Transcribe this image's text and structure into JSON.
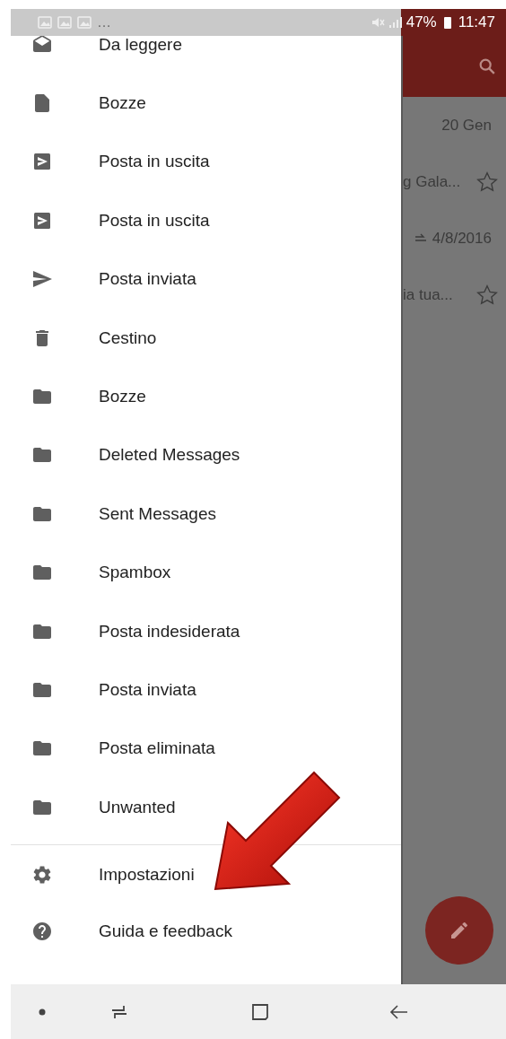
{
  "status_bar": {
    "notification_overflow": "…",
    "battery": "47%",
    "time": "11:47"
  },
  "drawer": {
    "items": [
      {
        "label": "Da leggere",
        "kind": "unread"
      },
      {
        "label": "Bozze",
        "kind": "draft"
      },
      {
        "label": "Posta in uscita",
        "kind": "outbox"
      },
      {
        "label": "Posta in uscita",
        "kind": "outbox"
      },
      {
        "label": "Posta inviata",
        "kind": "sent"
      },
      {
        "label": "Cestino",
        "kind": "trash"
      },
      {
        "label": "Bozze",
        "kind": "folder"
      },
      {
        "label": "Deleted Messages",
        "kind": "folder"
      },
      {
        "label": "Sent Messages",
        "kind": "folder"
      },
      {
        "label": "Spambox",
        "kind": "folder"
      },
      {
        "label": "Posta indesiderata",
        "kind": "folder"
      },
      {
        "label": "Posta inviata",
        "kind": "folder"
      },
      {
        "label": "Posta eliminata",
        "kind": "folder"
      },
      {
        "label": "Unwanted",
        "kind": "folder"
      }
    ],
    "footer_items": [
      {
        "label": "Impostazioni",
        "kind": "settings"
      },
      {
        "label": "Guida e feedback",
        "kind": "help"
      }
    ]
  },
  "background_list": [
    {
      "kind": "date",
      "text": "20 Gen"
    },
    {
      "kind": "snippet",
      "text": "g Gala...",
      "starred": false
    },
    {
      "kind": "date",
      "text": "4/8/2016",
      "replied": true
    },
    {
      "kind": "snippet",
      "text": "ia tua...",
      "starred": false
    }
  ]
}
